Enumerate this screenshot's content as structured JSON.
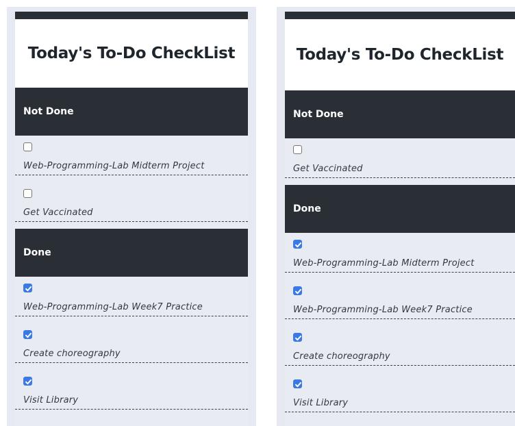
{
  "colors": {
    "dark": "#292f35",
    "accent": "#3b7ae4",
    "background": "#e9ebf3"
  },
  "left": {
    "title": "Today's To-Do CheckList",
    "not_done": {
      "label": "Not Done",
      "items": [
        {
          "text": "Web-Programming-Lab Midterm Project",
          "checked": false
        },
        {
          "text": "Get Vaccinated",
          "checked": false
        }
      ]
    },
    "done": {
      "label": "Done",
      "items": [
        {
          "text": "Web-Programming-Lab Week7 Practice",
          "checked": true
        },
        {
          "text": "Create choreography",
          "checked": true
        },
        {
          "text": "Visit Library",
          "checked": true
        }
      ]
    }
  },
  "right": {
    "title": "Today's To-Do CheckList",
    "not_done": {
      "label": "Not Done",
      "items": [
        {
          "text": "Get Vaccinated",
          "checked": false
        }
      ]
    },
    "done": {
      "label": "Done",
      "items": [
        {
          "text": "Web-Programming-Lab Midterm Project",
          "checked": true
        },
        {
          "text": "Web-Programming-Lab Week7 Practice",
          "checked": true
        },
        {
          "text": "Create choreography",
          "checked": true
        },
        {
          "text": "Visit Library",
          "checked": true
        }
      ]
    }
  }
}
